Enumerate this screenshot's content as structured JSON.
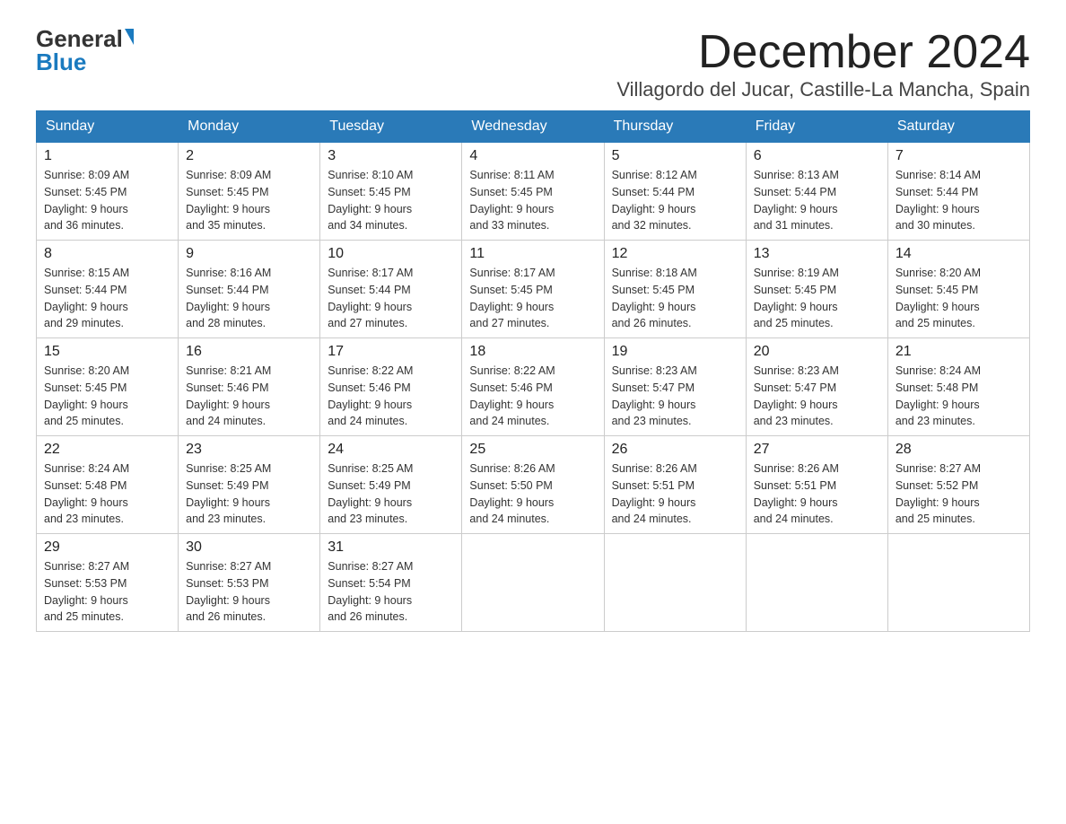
{
  "logo": {
    "general": "General",
    "blue": "Blue"
  },
  "title": "December 2024",
  "location": "Villagordo del Jucar, Castille-La Mancha, Spain",
  "weekdays": [
    "Sunday",
    "Monday",
    "Tuesday",
    "Wednesday",
    "Thursday",
    "Friday",
    "Saturday"
  ],
  "weeks": [
    [
      {
        "day": "1",
        "sunrise": "8:09 AM",
        "sunset": "5:45 PM",
        "daylight": "9 hours and 36 minutes."
      },
      {
        "day": "2",
        "sunrise": "8:09 AM",
        "sunset": "5:45 PM",
        "daylight": "9 hours and 35 minutes."
      },
      {
        "day": "3",
        "sunrise": "8:10 AM",
        "sunset": "5:45 PM",
        "daylight": "9 hours and 34 minutes."
      },
      {
        "day": "4",
        "sunrise": "8:11 AM",
        "sunset": "5:45 PM",
        "daylight": "9 hours and 33 minutes."
      },
      {
        "day": "5",
        "sunrise": "8:12 AM",
        "sunset": "5:44 PM",
        "daylight": "9 hours and 32 minutes."
      },
      {
        "day": "6",
        "sunrise": "8:13 AM",
        "sunset": "5:44 PM",
        "daylight": "9 hours and 31 minutes."
      },
      {
        "day": "7",
        "sunrise": "8:14 AM",
        "sunset": "5:44 PM",
        "daylight": "9 hours and 30 minutes."
      }
    ],
    [
      {
        "day": "8",
        "sunrise": "8:15 AM",
        "sunset": "5:44 PM",
        "daylight": "9 hours and 29 minutes."
      },
      {
        "day": "9",
        "sunrise": "8:16 AM",
        "sunset": "5:44 PM",
        "daylight": "9 hours and 28 minutes."
      },
      {
        "day": "10",
        "sunrise": "8:17 AM",
        "sunset": "5:44 PM",
        "daylight": "9 hours and 27 minutes."
      },
      {
        "day": "11",
        "sunrise": "8:17 AM",
        "sunset": "5:45 PM",
        "daylight": "9 hours and 27 minutes."
      },
      {
        "day": "12",
        "sunrise": "8:18 AM",
        "sunset": "5:45 PM",
        "daylight": "9 hours and 26 minutes."
      },
      {
        "day": "13",
        "sunrise": "8:19 AM",
        "sunset": "5:45 PM",
        "daylight": "9 hours and 25 minutes."
      },
      {
        "day": "14",
        "sunrise": "8:20 AM",
        "sunset": "5:45 PM",
        "daylight": "9 hours and 25 minutes."
      }
    ],
    [
      {
        "day": "15",
        "sunrise": "8:20 AM",
        "sunset": "5:45 PM",
        "daylight": "9 hours and 25 minutes."
      },
      {
        "day": "16",
        "sunrise": "8:21 AM",
        "sunset": "5:46 PM",
        "daylight": "9 hours and 24 minutes."
      },
      {
        "day": "17",
        "sunrise": "8:22 AM",
        "sunset": "5:46 PM",
        "daylight": "9 hours and 24 minutes."
      },
      {
        "day": "18",
        "sunrise": "8:22 AM",
        "sunset": "5:46 PM",
        "daylight": "9 hours and 24 minutes."
      },
      {
        "day": "19",
        "sunrise": "8:23 AM",
        "sunset": "5:47 PM",
        "daylight": "9 hours and 23 minutes."
      },
      {
        "day": "20",
        "sunrise": "8:23 AM",
        "sunset": "5:47 PM",
        "daylight": "9 hours and 23 minutes."
      },
      {
        "day": "21",
        "sunrise": "8:24 AM",
        "sunset": "5:48 PM",
        "daylight": "9 hours and 23 minutes."
      }
    ],
    [
      {
        "day": "22",
        "sunrise": "8:24 AM",
        "sunset": "5:48 PM",
        "daylight": "9 hours and 23 minutes."
      },
      {
        "day": "23",
        "sunrise": "8:25 AM",
        "sunset": "5:49 PM",
        "daylight": "9 hours and 23 minutes."
      },
      {
        "day": "24",
        "sunrise": "8:25 AM",
        "sunset": "5:49 PM",
        "daylight": "9 hours and 23 minutes."
      },
      {
        "day": "25",
        "sunrise": "8:26 AM",
        "sunset": "5:50 PM",
        "daylight": "9 hours and 24 minutes."
      },
      {
        "day": "26",
        "sunrise": "8:26 AM",
        "sunset": "5:51 PM",
        "daylight": "9 hours and 24 minutes."
      },
      {
        "day": "27",
        "sunrise": "8:26 AM",
        "sunset": "5:51 PM",
        "daylight": "9 hours and 24 minutes."
      },
      {
        "day": "28",
        "sunrise": "8:27 AM",
        "sunset": "5:52 PM",
        "daylight": "9 hours and 25 minutes."
      }
    ],
    [
      {
        "day": "29",
        "sunrise": "8:27 AM",
        "sunset": "5:53 PM",
        "daylight": "9 hours and 25 minutes."
      },
      {
        "day": "30",
        "sunrise": "8:27 AM",
        "sunset": "5:53 PM",
        "daylight": "9 hours and 26 minutes."
      },
      {
        "day": "31",
        "sunrise": "8:27 AM",
        "sunset": "5:54 PM",
        "daylight": "9 hours and 26 minutes."
      },
      null,
      null,
      null,
      null
    ]
  ],
  "labels": {
    "sunrise": "Sunrise:",
    "sunset": "Sunset:",
    "daylight": "Daylight:"
  },
  "accent_color": "#2a7ab8"
}
